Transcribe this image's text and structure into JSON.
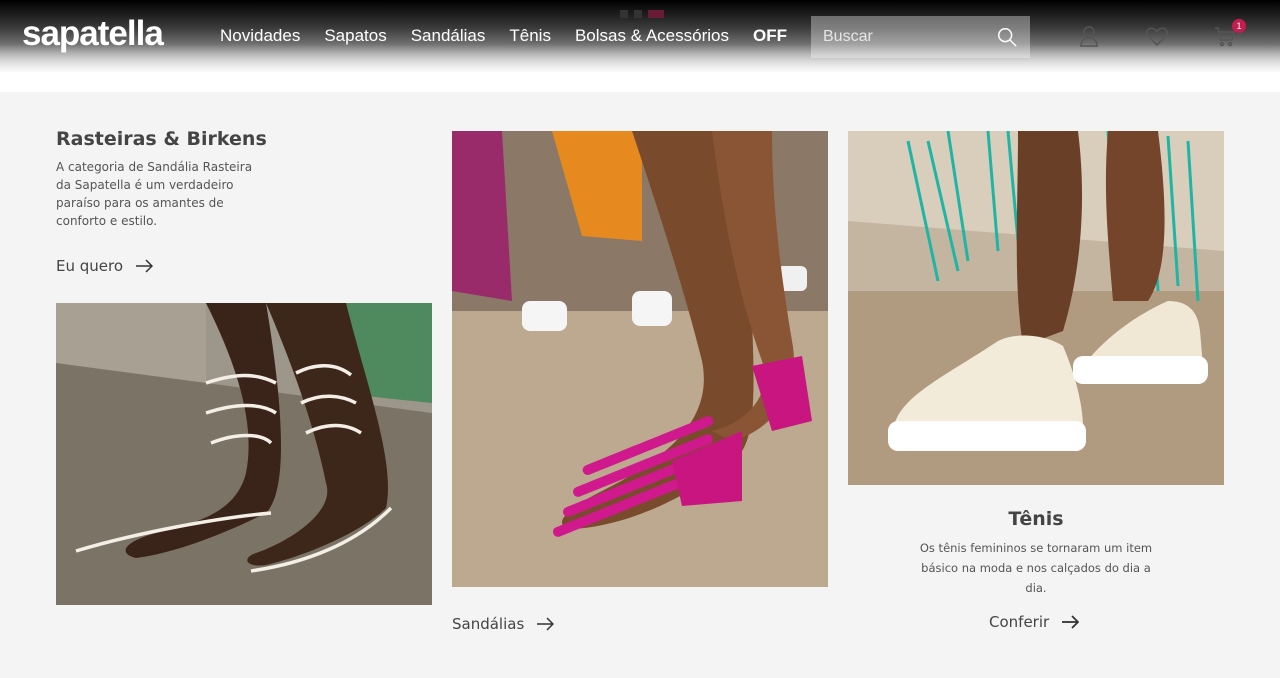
{
  "brand": {
    "logo": "sapatella"
  },
  "nav": {
    "items": [
      "Novidades",
      "Sapatos",
      "Sandálias",
      "Tênis",
      "Bolsas & Acessórios",
      "OFF"
    ]
  },
  "search": {
    "placeholder": "Buscar",
    "icon": "search-icon"
  },
  "header_icons": {
    "account": "user-icon",
    "wishlist": "heart-icon",
    "cart": "cart-icon",
    "cart_count": "1"
  },
  "slider": {
    "active_index": 3,
    "count": 3
  },
  "promo": {
    "title": "Rasteiras & Birkens",
    "description": "A categoria de Sandália Rasteira da Sapatella é um verdadeiro paraíso para os amantes de conforto e estilo.",
    "cta": "Eu quero"
  },
  "sandalias": {
    "cta": "Sandálias"
  },
  "tenis": {
    "title": "Tênis",
    "description": "Os tênis femininos se tornaram um item básico na moda e nos calçados do dia a dia.",
    "cta": "Conferir"
  },
  "colors": {
    "accent": "#c51d4f",
    "slider_active": "#6a1c34",
    "background": "#f4f4f4"
  }
}
